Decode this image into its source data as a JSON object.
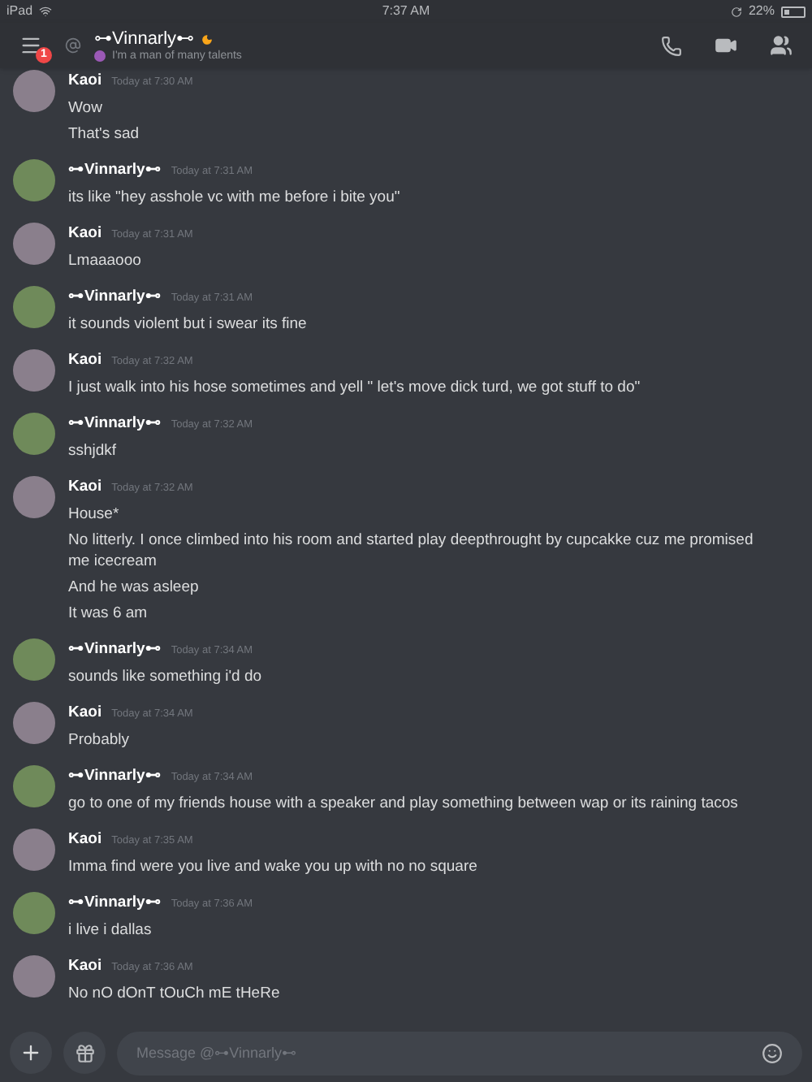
{
  "status_bar": {
    "device": "iPad",
    "time": "7:37 AM",
    "battery": "22%"
  },
  "header": {
    "badge": "1",
    "name": "⊶Vinnarly⊷",
    "custom_status": "I'm a man of many talents"
  },
  "messages": [
    {
      "kind": "friend",
      "author": "Kaoi",
      "time": "Today at 7:30 AM",
      "lines": [
        "Wow",
        "That's sad"
      ]
    },
    {
      "kind": "self",
      "author": "⊶Vinnarly⊷",
      "time": "Today at 7:31 AM",
      "lines": [
        "its like \"hey asshole vc with me before i bite you\""
      ]
    },
    {
      "kind": "friend",
      "author": "Kaoi",
      "time": "Today at 7:31 AM",
      "lines": [
        "Lmaaaooo"
      ]
    },
    {
      "kind": "self",
      "author": "⊶Vinnarly⊷",
      "time": "Today at 7:31 AM",
      "lines": [
        "it sounds violent but i swear its fine"
      ]
    },
    {
      "kind": "friend",
      "author": "Kaoi",
      "time": "Today at 7:32 AM",
      "lines": [
        "I just walk into his hose sometimes and yell \" let's move dick turd, we got stuff to do\""
      ]
    },
    {
      "kind": "self",
      "author": "⊶Vinnarly⊷",
      "time": "Today at 7:32 AM",
      "lines": [
        "sshjdkf"
      ]
    },
    {
      "kind": "friend",
      "author": "Kaoi",
      "time": "Today at 7:32 AM",
      "lines": [
        "House*",
        "No litterly. I once climbed into his room and started play deepthrought by cupcakke cuz me promised me icecream",
        "And he was asleep",
        "It was 6 am"
      ]
    },
    {
      "kind": "self",
      "author": "⊶Vinnarly⊷",
      "time": "Today at 7:34 AM",
      "lines": [
        "sounds like something i'd do"
      ]
    },
    {
      "kind": "friend",
      "author": "Kaoi",
      "time": "Today at 7:34 AM",
      "lines": [
        "Probably"
      ]
    },
    {
      "kind": "self",
      "author": "⊶Vinnarly⊷",
      "time": "Today at 7:34 AM",
      "lines": [
        "go to one of my friends house with a speaker and play something between wap or its raining tacos"
      ]
    },
    {
      "kind": "friend",
      "author": "Kaoi",
      "time": "Today at 7:35 AM",
      "lines": [
        "Imma find were you live and wake you up with no no square"
      ]
    },
    {
      "kind": "self",
      "author": "⊶Vinnarly⊷",
      "time": "Today at 7:36 AM",
      "lines": [
        "i live i dallas"
      ]
    },
    {
      "kind": "friend",
      "author": "Kaoi",
      "time": "Today at 7:36 AM",
      "lines": [
        "No nO dOnT tOuCh mE tHeRe"
      ]
    }
  ],
  "composer": {
    "placeholder": "Message @⊶Vinnarly⊷"
  }
}
